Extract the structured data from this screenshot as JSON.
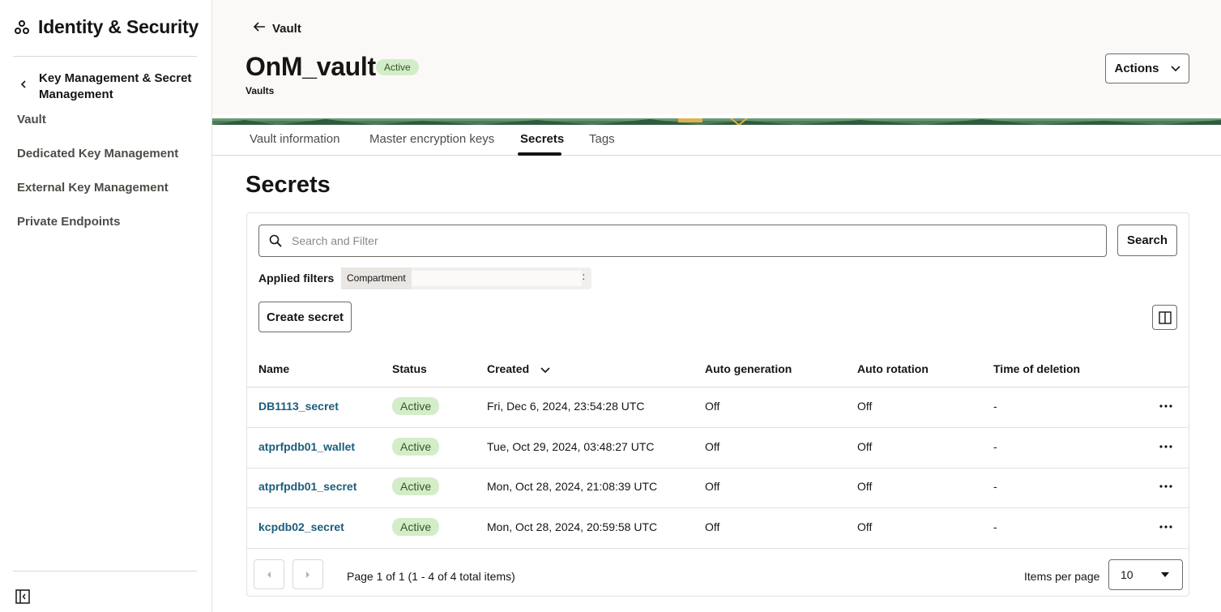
{
  "sidebar": {
    "title": "Identity & Security",
    "back_label": "Key Management & Secret Management",
    "items": [
      {
        "label": "Vault"
      },
      {
        "label": "Dedicated Key Management"
      },
      {
        "label": "External Key Management"
      },
      {
        "label": "Private Endpoints"
      }
    ]
  },
  "header": {
    "back_link": "Vault",
    "title": "OnM_vault",
    "status": "Active",
    "subtitle": "Vaults",
    "actions_label": "Actions"
  },
  "tabs": [
    {
      "label": "Vault information"
    },
    {
      "label": "Master encryption keys"
    },
    {
      "label": "Secrets",
      "active": true
    },
    {
      "label": "Tags"
    }
  ],
  "section_title": "Secrets",
  "toolbar": {
    "search_placeholder": "Search and Filter",
    "search_button": "Search",
    "applied_filters_label": "Applied filters",
    "filter_chip_label": "Compartment",
    "filter_chip_more": ":",
    "create_button": "Create secret"
  },
  "table": {
    "columns": [
      "Name",
      "Status",
      "Created",
      "Auto generation",
      "Auto rotation",
      "Time of deletion"
    ],
    "rows": [
      {
        "name": "DB1113_secret",
        "status": "Active",
        "created": "Fri, Dec 6, 2024, 23:54:28 UTC",
        "auto_generation": "Off",
        "auto_rotation": "Off",
        "time_of_deletion": "-"
      },
      {
        "name": "atprfpdb01_wallet",
        "status": "Active",
        "created": "Tue, Oct 29, 2024, 03:48:27 UTC",
        "auto_generation": "Off",
        "auto_rotation": "Off",
        "time_of_deletion": "-"
      },
      {
        "name": "atprfpdb01_secret",
        "status": "Active",
        "created": "Mon, Oct 28, 2024, 21:08:39 UTC",
        "auto_generation": "Off",
        "auto_rotation": "Off",
        "time_of_deletion": "-"
      },
      {
        "name": "kcpdb02_secret",
        "status": "Active",
        "created": "Mon, Oct 28, 2024, 20:59:58 UTC",
        "auto_generation": "Off",
        "auto_rotation": "Off",
        "time_of_deletion": "-"
      }
    ]
  },
  "pagination": {
    "summary": "Page 1 of 1 (1 - 4 of 4 total items)",
    "items_per_page_label": "Items per page",
    "items_per_page": "10"
  },
  "colors": {
    "link": "#1b5d7d",
    "badge_bg": "#d4edc9",
    "badge_text": "#315627",
    "header_bg": "#fbf9f8",
    "banner_green": "#3d6b4a"
  },
  "icons": [
    "identity-icon",
    "chevron-left-icon",
    "arrow-left-icon",
    "chevron-down-icon",
    "search-icon",
    "columns-icon",
    "sort-desc-icon",
    "more-actions-icon",
    "page-prev-icon",
    "page-next-icon",
    "select-caret-icon",
    "collapse-sidebar-icon"
  ]
}
